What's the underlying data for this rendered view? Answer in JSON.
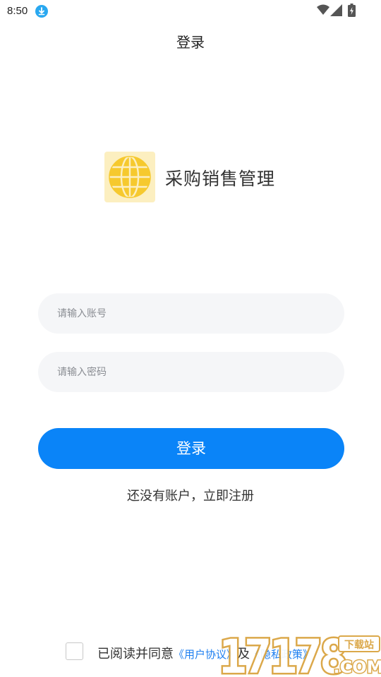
{
  "status_bar": {
    "time": "8:50"
  },
  "header": {
    "title": "登录"
  },
  "app": {
    "name": "采购销售管理",
    "logo_icon": "globe-icon"
  },
  "form": {
    "account_placeholder": "请输入账号",
    "account_value": "",
    "password_placeholder": "请输入密码",
    "password_value": "",
    "login_label": "登录",
    "register_text": "还没有账户，立即注册"
  },
  "agreement": {
    "checked": false,
    "prefix": "已阅读并同意",
    "user_agreement": "《用户协议》",
    "conjunction": "及",
    "privacy_policy": "《隐私政策》"
  },
  "watermark": {
    "number": "17178",
    "tag": "下载站",
    "suffix": ".COM"
  },
  "colors": {
    "primary": "#0a84f8",
    "link": "#1e7ff0",
    "input_bg": "#f5f6f8",
    "logo_bg": "#fcefc0",
    "logo_globe": "#f6c92e",
    "watermark": "#d9a13b"
  }
}
